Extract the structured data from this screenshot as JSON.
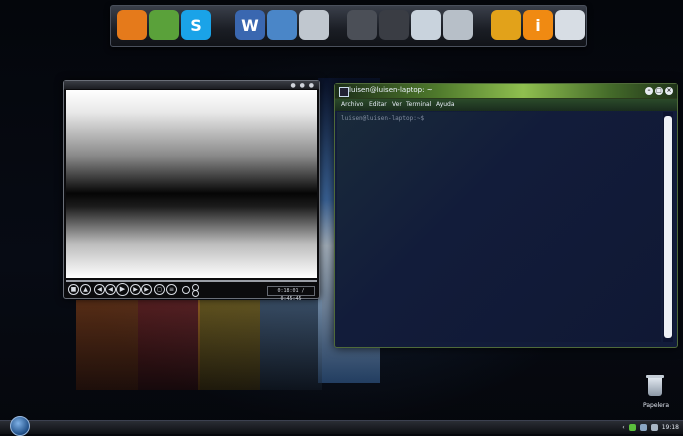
{
  "dock": {
    "items": [
      {
        "icon": "firefox-icon",
        "color": "#e57a1b"
      },
      {
        "icon": "messenger-icon",
        "color": "#5aa13a"
      },
      {
        "icon": "skype-icon",
        "color": "#1aa3e8",
        "glyph": "S"
      },
      {
        "icon": "word-icon",
        "color": "#3a67b0",
        "glyph": "W"
      },
      {
        "icon": "file-manager-icon",
        "color": "#4a86c8"
      },
      {
        "icon": "paint-icon",
        "color": "#c0c7cf"
      },
      {
        "icon": "gun-icon",
        "color": "#4b4f57"
      },
      {
        "icon": "camera-icon",
        "color": "#3a3d44"
      },
      {
        "icon": "monitor-icon",
        "color": "#c9d3dd"
      },
      {
        "icon": "phone-icon",
        "color": "#b7bfc8"
      },
      {
        "icon": "keys-icon",
        "color": "#e2a21a"
      },
      {
        "icon": "info-icon",
        "color": "#f08a12",
        "glyph": "i"
      },
      {
        "icon": "weather-icon",
        "color": "#d7dde4"
      }
    ]
  },
  "player": {
    "time": "0:18:01 / 0:45:45"
  },
  "terminal": {
    "title": "luisen@luisen-laptop: ~",
    "menu": [
      "Archivo",
      "Editar",
      "Ver",
      "Terminal",
      "Ayuda"
    ],
    "prompt": "luisen@luisen-laptop:~$ "
  },
  "desktop": {
    "trash_label": "Papelera"
  },
  "taskbar": {
    "clock": "19:18"
  }
}
